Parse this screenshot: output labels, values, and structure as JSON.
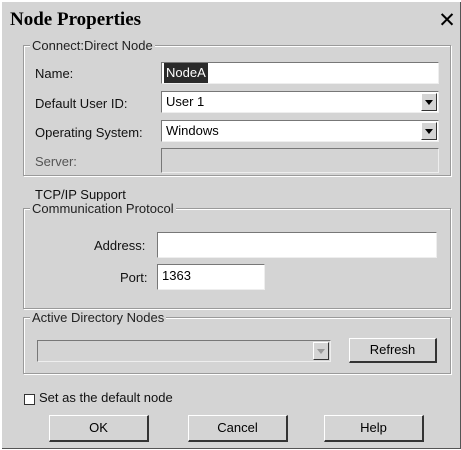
{
  "window": {
    "title": "Node Properties",
    "close_glyph": "✕"
  },
  "connect_direct": {
    "legend": "Connect:Direct Node",
    "name_label": "Name:",
    "name_value": "NodeA",
    "user_label": "Default User ID:",
    "user_value": "User 1",
    "os_label": "Operating System:",
    "os_value": "Windows",
    "server_label": "Server:",
    "server_value": ""
  },
  "tcpip": {
    "heading": "TCP/IP Support",
    "legend": "Communication Protocol",
    "address_label": "Address:",
    "address_value": "",
    "port_label": "Port:",
    "port_value": "1363"
  },
  "active_directory": {
    "legend": "Active Directory Nodes",
    "selected_value": "",
    "refresh_label": "Refresh"
  },
  "default_node": {
    "label": "Set as the default node",
    "checked": false
  },
  "buttons": {
    "ok": "OK",
    "cancel": "Cancel",
    "help": "Help"
  }
}
